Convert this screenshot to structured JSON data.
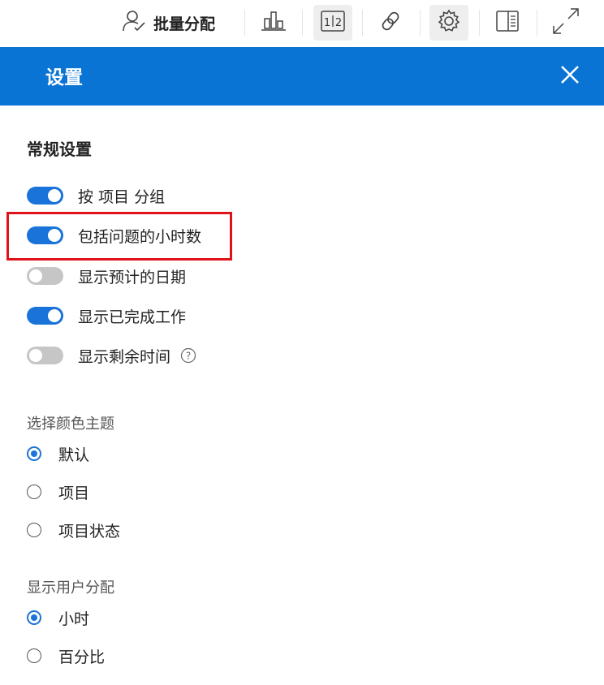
{
  "toolbar": {
    "bulk_assign_label": "批量分配",
    "icons": [
      "bulk-assign-icon",
      "bar-chart-icon",
      "page-split-icon",
      "link-icon",
      "gear-icon",
      "side-panel-icon",
      "expand-icon"
    ],
    "active_icons": [
      "page-split-icon",
      "gear-icon"
    ]
  },
  "header": {
    "title": "设置",
    "color": "#0a74d4"
  },
  "general": {
    "title": "常规设置",
    "toggles": [
      {
        "label": "按 项目 分组",
        "on": true
      },
      {
        "label": "包括问题的小时数",
        "on": true,
        "highlighted": true
      },
      {
        "label": "显示预计的日期",
        "on": false
      },
      {
        "label": "显示已完成工作",
        "on": true
      },
      {
        "label": "显示剩余时间",
        "on": false,
        "help_icon": true
      }
    ]
  },
  "color_theme": {
    "title": "选择颜色主题",
    "options": [
      {
        "label": "默认",
        "selected": true
      },
      {
        "label": "项目",
        "selected": false
      },
      {
        "label": "项目状态",
        "selected": false
      }
    ]
  },
  "user_allocation": {
    "title": "显示用户分配",
    "options": [
      {
        "label": "小时",
        "selected": true
      },
      {
        "label": "百分比",
        "selected": false
      }
    ]
  },
  "colors": {
    "accent": "#1a73d9",
    "toggle_off": "#c6c6c6",
    "highlight": "#e0121b"
  }
}
